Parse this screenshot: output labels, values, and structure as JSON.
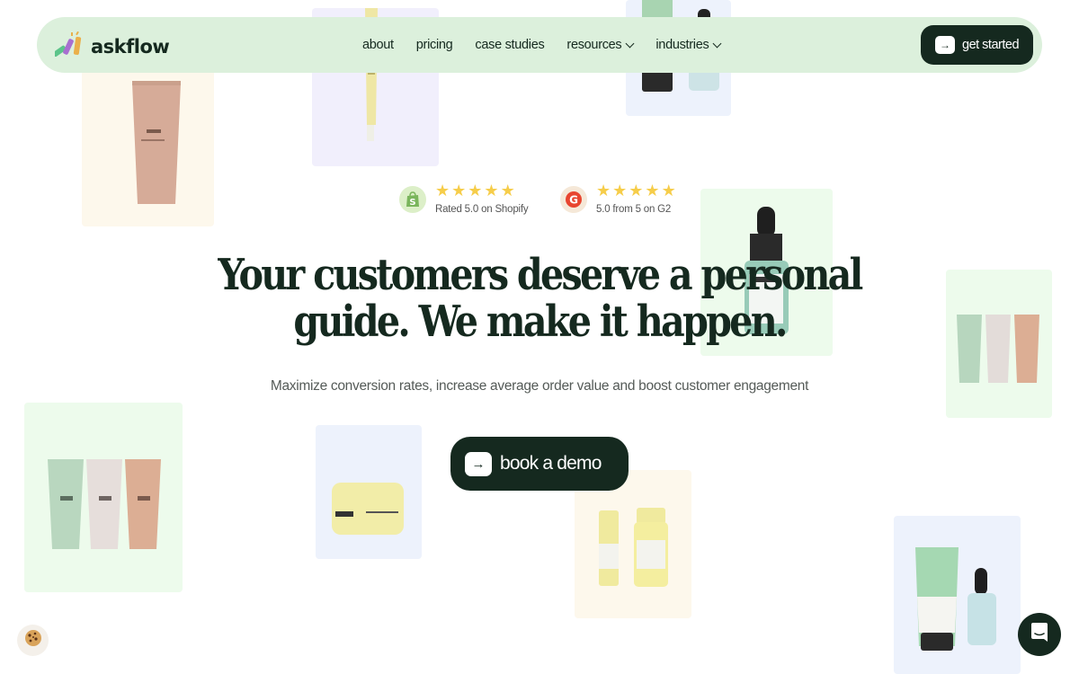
{
  "brand": {
    "name": "askflow",
    "logo_icon": "bars-logo-icon"
  },
  "nav": {
    "links": [
      {
        "label": "about",
        "has_dropdown": false
      },
      {
        "label": "pricing",
        "has_dropdown": false
      },
      {
        "label": "case studies",
        "has_dropdown": false
      },
      {
        "label": "resources",
        "has_dropdown": true
      },
      {
        "label": "industries",
        "has_dropdown": true
      }
    ],
    "cta": {
      "label": "get started",
      "icon": "arrow-right-icon"
    }
  },
  "ratings": [
    {
      "platform": "Shopify",
      "stars": 5,
      "max_stars": 5,
      "text": "Rated 5.0 on Shopify",
      "icon": "shopify-icon"
    },
    {
      "platform": "G2",
      "stars": 5,
      "max_stars": 5,
      "text": "5.0 from 5 on G2",
      "icon": "g2-icon"
    }
  ],
  "hero": {
    "headline_line1": "Your customers deserve a personal",
    "headline_line2": "guide. We make it happen.",
    "subheadline": "Maximize conversion rates, increase average order value and boost customer engagement",
    "cta": {
      "label": "book a demo",
      "icon": "arrow-right-icon"
    }
  },
  "widgets": {
    "cookie_icon": "cookie-icon",
    "chat_icon": "chat-icon"
  },
  "colors": {
    "primary_dark": "#15291f",
    "nav_bg": "#dcf0dc",
    "star": "#f6cd4a",
    "subtext": "#555b58",
    "tile_mint": "#edfbec",
    "tile_cream": "#fdf8ec",
    "tile_lavender": "#f1effc",
    "tile_blue": "#edf2fc"
  }
}
